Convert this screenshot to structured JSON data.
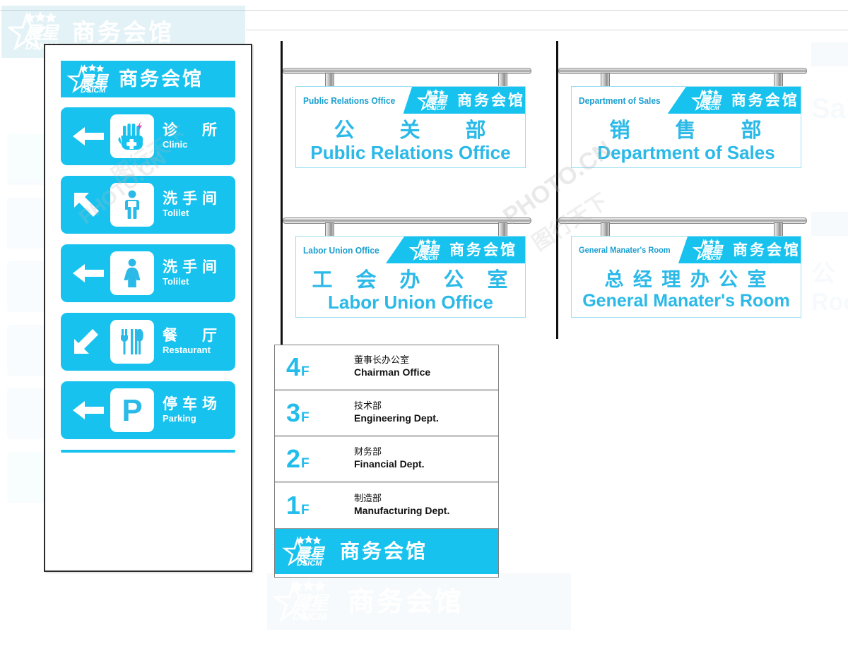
{
  "brand": {
    "cn": "商务会馆",
    "logo_word": "晨星",
    "logo_sub": "DSICM",
    "accent": "#17C3EE",
    "sign_text_color": "#2bb9e8",
    "tab_text_color": "#1b9fd0"
  },
  "directory_panel": {
    "rows": [
      {
        "cn": "诊　所",
        "en": "Clinic",
        "arrow": "left",
        "icon": "hand-cross-clinic-icon"
      },
      {
        "cn": "洗手间",
        "en": "Tolilet",
        "arrow": "up-left",
        "icon": "man-restroom-icon"
      },
      {
        "cn": "洗手间",
        "en": "Tolilet",
        "arrow": "left",
        "icon": "woman-restroom-icon"
      },
      {
        "cn": "餐　厅",
        "en": "Restaurant",
        "arrow": "down-left",
        "icon": "fork-knife-icon"
      },
      {
        "cn": "停车场",
        "en": "Parking",
        "arrow": "left",
        "icon": "parking-p-icon"
      }
    ]
  },
  "hanging_signs": [
    {
      "tab": "Public Relations Office",
      "cn": "公　　关　　部",
      "en": "Public Relations Office"
    },
    {
      "tab": "Department of Sales",
      "cn": "销　　售　　部",
      "en": "Department of Sales"
    },
    {
      "tab": "Labor Union Office",
      "cn": "工　会　办　公　室",
      "en": "Labor  Union  Office"
    },
    {
      "tab": "General Manater's Room",
      "cn": "总 经 理 办 公 室",
      "en": "General Manater's Room"
    }
  ],
  "floor_directory": {
    "rows": [
      {
        "num": "4",
        "unit": "F",
        "cn": "董事长办公室",
        "en": "Chairman  Office"
      },
      {
        "num": "3",
        "unit": "F",
        "cn": "技术部",
        "en": "Engineering  Dept."
      },
      {
        "num": "2",
        "unit": "F",
        "cn": "财务部",
        "en": "Financial  Dept."
      },
      {
        "num": "1",
        "unit": "F",
        "cn": "制造部",
        "en": "Manufacturing  Dept."
      }
    ]
  },
  "watermarks": {
    "site": "PHOTO.CN",
    "mark": "图行天下"
  }
}
